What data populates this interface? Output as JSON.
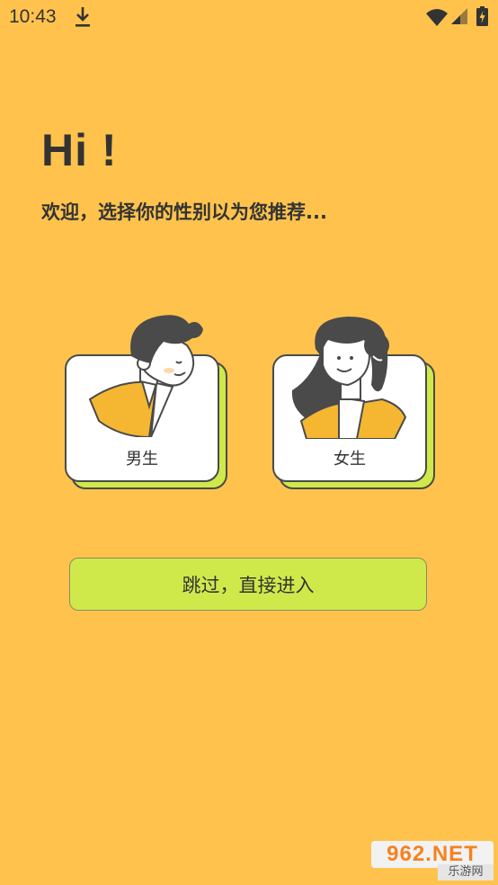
{
  "status_bar": {
    "time": "10:43",
    "icons": [
      "download-icon",
      "wifi-icon",
      "signal-icon",
      "battery-icon"
    ]
  },
  "greeting": {
    "title": "Hi !",
    "subtitle": "欢迎，选择你的性别以为您推荐..."
  },
  "gender_options": [
    {
      "label": "男生"
    },
    {
      "label": "女生"
    }
  ],
  "skip_button": {
    "label": "跳过，直接进入"
  },
  "watermark": {
    "text": "962.NET",
    "sub": "乐游网"
  },
  "colors": {
    "background": "#ffc34d",
    "accent": "#cfe94b",
    "text": "#333333",
    "outline": "#4a4a4a"
  }
}
